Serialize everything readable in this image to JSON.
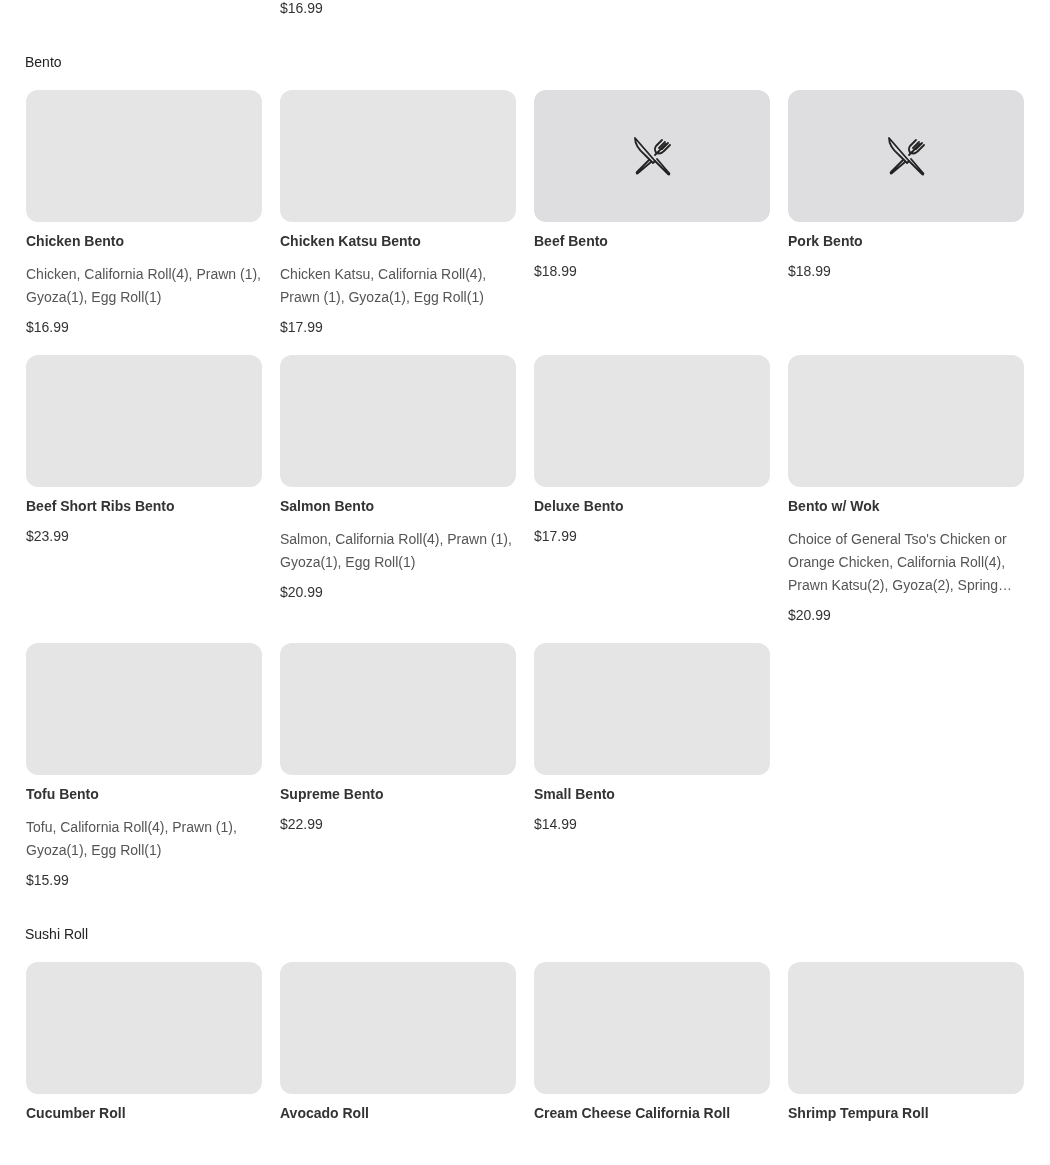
{
  "top_price": "$16.99",
  "sections": [
    {
      "title": "Bento",
      "items": [
        {
          "name": "Chicken Bento",
          "description": "Chicken, California Roll(4), Prawn (1), Gyoza(1), Egg Roll(1)",
          "price": "$16.99",
          "has_icon": false
        },
        {
          "name": "Chicken Katsu Bento",
          "description": "Chicken Katsu, California Roll(4), Prawn (1), Gyoza(1), Egg Roll(1)",
          "price": "$17.99",
          "has_icon": false
        },
        {
          "name": "Beef Bento",
          "price": "$18.99",
          "has_icon": true
        },
        {
          "name": "Pork Bento",
          "price": "$18.99",
          "has_icon": true
        },
        {
          "name": "Beef Short Ribs Bento",
          "price": "$23.99",
          "has_icon": false
        },
        {
          "name": "Salmon Bento",
          "description": "Salmon, California Roll(4), Prawn (1), Gyoza(1), Egg Roll(1)",
          "price": "$20.99",
          "has_icon": false
        },
        {
          "name": "Deluxe Bento",
          "price": "$17.99",
          "has_icon": false
        },
        {
          "name": "Bento w/ Wok",
          "description": "Choice of General Tso's Chicken or Orange Chicken, California Roll(4), Prawn Katsu(2), Gyoza(2), Spring…",
          "price": "$20.99",
          "has_icon": false
        },
        {
          "name": "Tofu Bento",
          "description": "Tofu, California Roll(4), Prawn (1), Gyoza(1), Egg Roll(1)",
          "price": "$15.99",
          "has_icon": false
        },
        {
          "name": "Supreme Bento",
          "price": "$22.99",
          "has_icon": false
        },
        {
          "name": "Small Bento",
          "price": "$14.99",
          "has_icon": false
        }
      ]
    },
    {
      "title": "Sushi Roll",
      "items": [
        {
          "name": "Cucumber Roll",
          "has_icon": false
        },
        {
          "name": "Avocado Roll",
          "has_icon": false
        },
        {
          "name": "Cream Cheese California Roll",
          "has_icon": false
        },
        {
          "name": "Shrimp Tempura Roll",
          "has_icon": false
        }
      ]
    }
  ]
}
